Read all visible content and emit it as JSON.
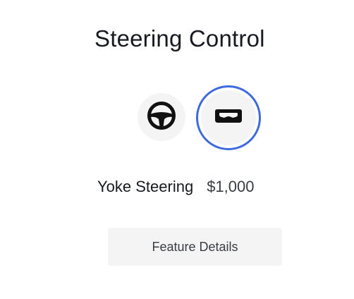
{
  "section": {
    "title": "Steering Control"
  },
  "options": [
    {
      "id": "wheel",
      "icon": "steering-wheel-icon",
      "selected": false
    },
    {
      "id": "yoke",
      "icon": "yoke-icon",
      "selected": true
    }
  ],
  "selected_option": {
    "name": "Yoke Steering",
    "price": "$1,000"
  },
  "actions": {
    "feature_details_label": "Feature Details"
  },
  "colors": {
    "selection_ring": "#3e6ae1",
    "option_background": "#f4f4f4",
    "text_primary": "#171a20",
    "text_secondary": "#393c41"
  }
}
